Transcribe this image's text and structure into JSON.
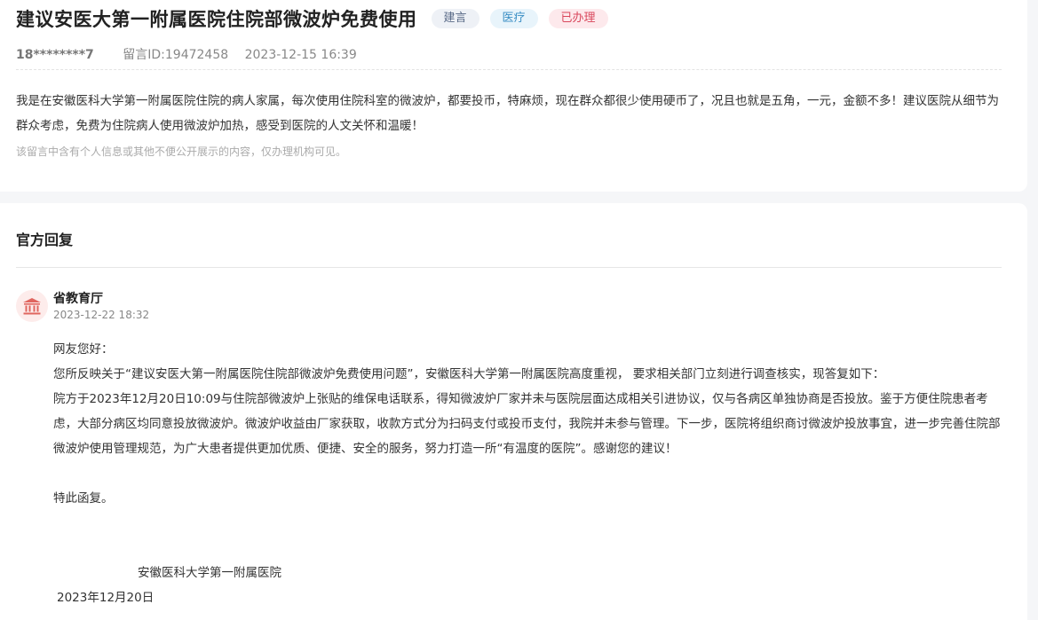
{
  "message": {
    "title": "建议安医大第一附属医院住院部微波炉免费使用",
    "tags": [
      "建言",
      "医疗",
      "已办理"
    ],
    "user": "18********7",
    "message_id": "留言ID:19472458",
    "datetime": "2023-12-15 16:39",
    "content": "我是在安徽医科大学第一附属医院住院的病人家属，每次使用住院科室的微波炉，都要投币，特麻烦，现在群众都很少使用硬币了，况且也就是五角，一元，金额不多！建议医院从细节为群众考虑，免费为住院病人使用微波炉加热，感受到医院的人文关怀和温暖！",
    "privacy_notice": "该留言中含有个人信息或其他不便公开展示的内容，仅办理机构可见。"
  },
  "reply": {
    "heading": "官方回复",
    "org_name": "省教育厅",
    "org_time": "2023-12-22 18:32",
    "greeting": "网友您好：",
    "line1": "您所反映关于“建议安医大第一附属医院住院部微波炉免费使用问题”，安徽医科大学第一附属医院高度重视， 要求相关部门立刻进行调查核实，现答复如下：",
    "paragraph": "院方于2023年12月20日10:09与住院部微波炉上张贴的维保电话联系，得知微波炉厂家并未与医院层面达成相关引进协议，仅与各病区单独协商是否投放。鉴于方便住院患者考虑，大部分病区均同意投放微波炉。微波炉收益由厂家获取，收款方式分为扫码支付或投币支付，我院并未参与管理。下一步，医院将组织商讨微波炉投放事宜，进一步完善住院部微波炉使用管理规范，为广大患者提供更加优质、便捷、安全的服务，努力打造一所“有温度的医院”。感谢您的建议！",
    "closing": "特此函复。",
    "sign_org": "安徽医科大学第一附属医院",
    "sign_date": "2023年12月20日"
  },
  "icons": {
    "org_avatar": "government-building-icon"
  },
  "colors": {
    "tag_suggestion": "#5a6b88",
    "tag_medical": "#3a8ec4",
    "tag_done": "#d9475c",
    "avatar_icon": "#e0665f"
  }
}
